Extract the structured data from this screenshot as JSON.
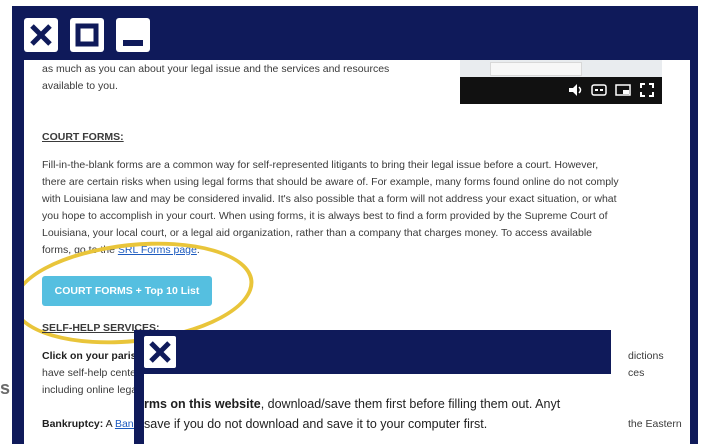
{
  "titlebar": {
    "close_icon": "close-icon",
    "maximize_icon": "maximize-icon",
    "minimize_icon": "minimize-icon"
  },
  "intro": {
    "line1": "as much as you can about your legal issue and the services and resources",
    "line2": "available to you."
  },
  "video": {
    "icons": [
      "volume-icon",
      "captions-icon",
      "picture-in-picture-icon",
      "fullscreen-icon"
    ]
  },
  "court_forms": {
    "heading": "COURT FORMS:",
    "lines": [
      "Fill-in-the-blank forms are a common way for self-represented litigants to bring their legal issue before a court. However,",
      "there are certain risks when using legal forms that should be aware of. For example, many forms found online do not comply",
      "with Louisiana law and may be considered invalid. It's also possible that a form will not address your exact situation, or what",
      "you hope to accomplish in your court. When using forms, it is always best to find a form provided by the Supreme Court of",
      "Louisiana, your local court, or a legal aid organization, rather than a company that charges money. To access available"
    ],
    "last_line_prefix": "forms, go to the ",
    "last_line_link": "SRL Forms page",
    "last_line_suffix": ".",
    "button_label": "COURT FORMS + Top 10 List"
  },
  "self_help": {
    "heading": "SELF-HELP SERVICES:",
    "parish_bold": "Click on your parish",
    "line2_start": "have self-help cente",
    "line3_start": "including online lega",
    "right1": "dictions",
    "right2": "ces",
    "bankruptcy_label": "Bankruptcy:",
    "bankruptcy_text": " A ",
    "bankruptcy_link": "Bankr",
    "bankruptcy_right": "the Eastern"
  },
  "popup": {
    "line1_bold": "rms on this website",
    "line1_rest": ", download/save them first before filling them out. Anyt",
    "line2": "save if you do not download and save it to your computer first."
  },
  "side_letter": "s"
}
